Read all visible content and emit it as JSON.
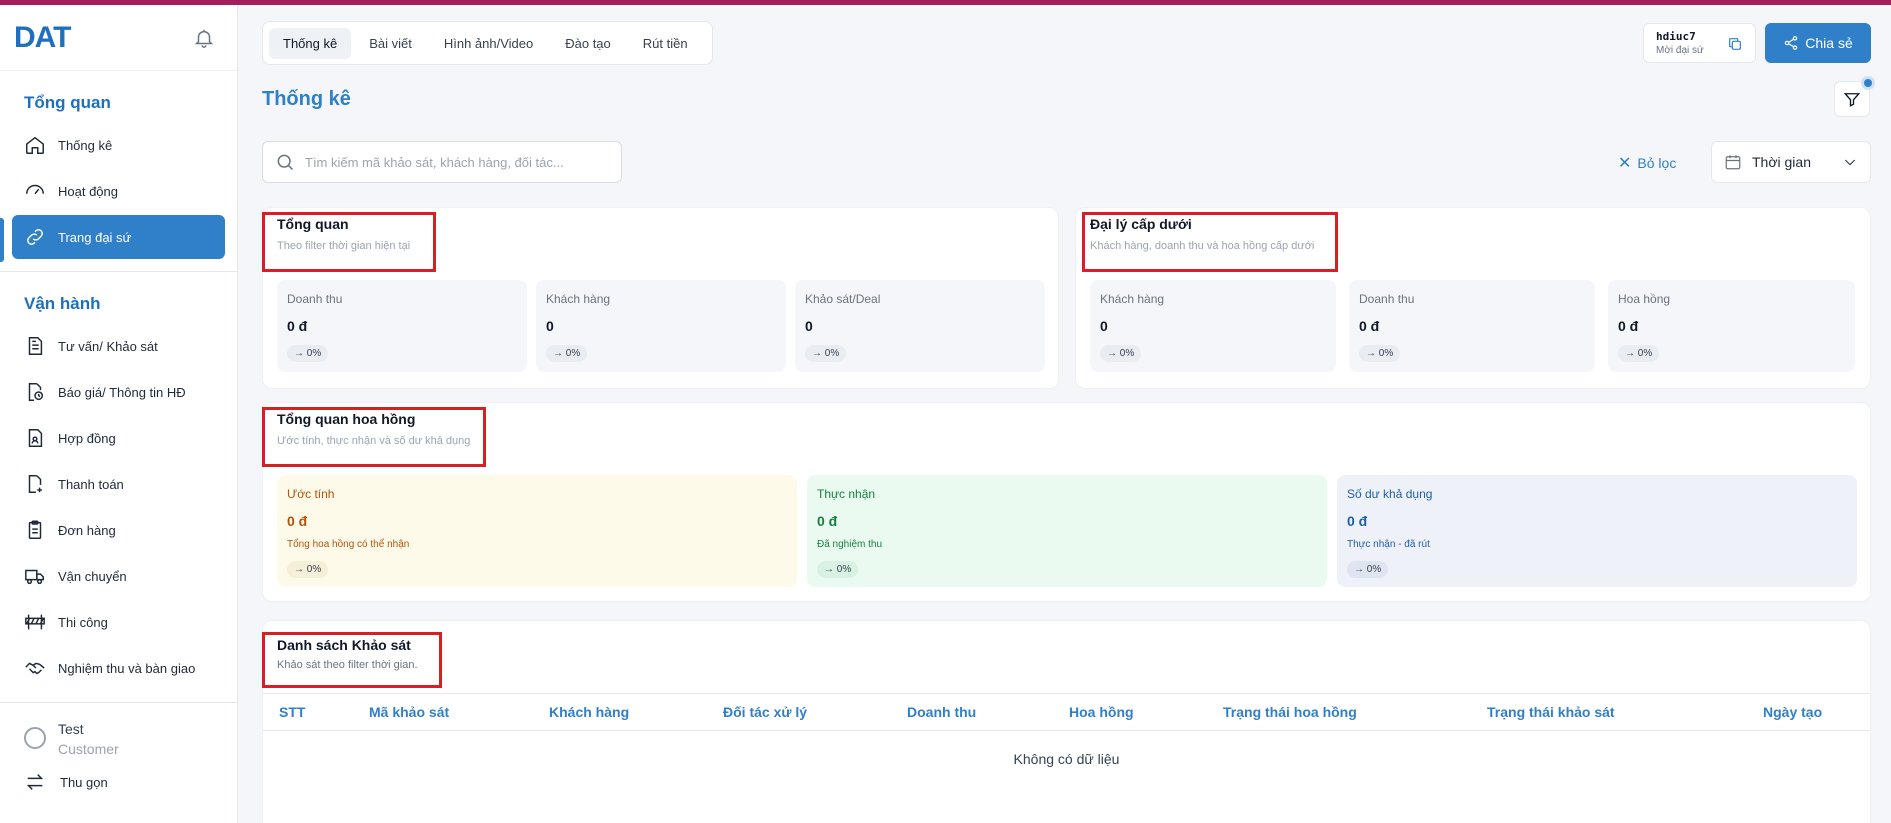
{
  "app": {
    "logo": "DAT"
  },
  "sidebar": {
    "section_overview": "Tổng quan",
    "overview_items": [
      {
        "label": "Thống kê",
        "icon": "home-icon"
      },
      {
        "label": "Hoạt động",
        "icon": "gauge-icon"
      },
      {
        "label": "Trang đại sứ",
        "icon": "link-icon",
        "active": true
      }
    ],
    "section_ops": "Vận hành",
    "ops_items": [
      {
        "label": "Tư vấn/ Khảo sát",
        "icon": "document-icon"
      },
      {
        "label": "Báo giá/ Thông tin HĐ",
        "icon": "file-clock-icon"
      },
      {
        "label": "Hợp đồng",
        "icon": "contract-icon"
      },
      {
        "label": "Thanh toán",
        "icon": "file-plus-icon"
      },
      {
        "label": "Đơn hàng",
        "icon": "clipboard-icon"
      },
      {
        "label": "Vận chuyển",
        "icon": "truck-icon"
      },
      {
        "label": "Thi công",
        "icon": "barrier-icon"
      },
      {
        "label": "Nghiệm thu và bàn giao",
        "icon": "handshake-icon"
      }
    ],
    "user_name": "Test",
    "user_role": "Customer",
    "collapse_label": "Thu gọn"
  },
  "header": {
    "tabs": [
      "Thống kê",
      "Bài viết",
      "Hình ảnh/Video",
      "Đào tạo",
      "Rút tiền"
    ],
    "active_tab": 0,
    "ref_code": "hdiuc7",
    "ref_sub": "Mời đại sứ",
    "share_label": "Chia sẻ"
  },
  "page": {
    "title": "Thống kê",
    "search_placeholder": "Tìm kiếm mã khảo sát, khách hàng, đối tác...",
    "clear_filter": "Bỏ lọc",
    "time_label": "Thời gian"
  },
  "overview": {
    "title": "Tổng quan",
    "subtitle": "Theo filter thời gian hiện tại",
    "stats": [
      {
        "label": "Doanh thu",
        "value": "0 đ",
        "change": "→ 0%"
      },
      {
        "label": "Khách hàng",
        "value": "0",
        "change": "→ 0%"
      },
      {
        "label": "Khảo sát/Deal",
        "value": "0",
        "change": "→ 0%"
      }
    ]
  },
  "agents": {
    "title": "Đại lý cấp dưới",
    "subtitle": "Khách hàng, doanh thu và hoa hồng cấp dưới",
    "stats": [
      {
        "label": "Khách hàng",
        "value": "0",
        "change": "→ 0%"
      },
      {
        "label": "Doanh thu",
        "value": "0 đ",
        "change": "→ 0%"
      },
      {
        "label": "Hoa hồng",
        "value": "0 đ",
        "change": "→ 0%"
      }
    ]
  },
  "commission": {
    "title": "Tổng quan hoa hồng",
    "subtitle": "Ước tính, thực nhận và số dư khả dụng",
    "stats": [
      {
        "label": "Ước tính",
        "value": "0 đ",
        "note": "Tổng hoa hồng có thể nhận",
        "change": "→ 0%"
      },
      {
        "label": "Thực nhận",
        "value": "0 đ",
        "note": "Đã nghiệm thu",
        "change": "→ 0%"
      },
      {
        "label": "Số dư khả dụng",
        "value": "0 đ",
        "note": "Thực nhận - đã rút",
        "change": "→ 0%"
      }
    ]
  },
  "surveys": {
    "title": "Danh sách Khảo sát",
    "subtitle": "Khảo sát theo filter thời gian.",
    "columns": [
      "STT",
      "Mã khảo sát",
      "Khách hàng",
      "Đối tác xử lý",
      "Doanh thu",
      "Hoa hồng",
      "Trạng thái hoa hồng",
      "Trạng thái khảo sát",
      "Ngày tạo"
    ],
    "empty_text": "Không có dữ liệu"
  },
  "colors": {
    "accent": "#2f80c8",
    "top_line": "#a51d5a",
    "highlight": "#d81f26"
  }
}
